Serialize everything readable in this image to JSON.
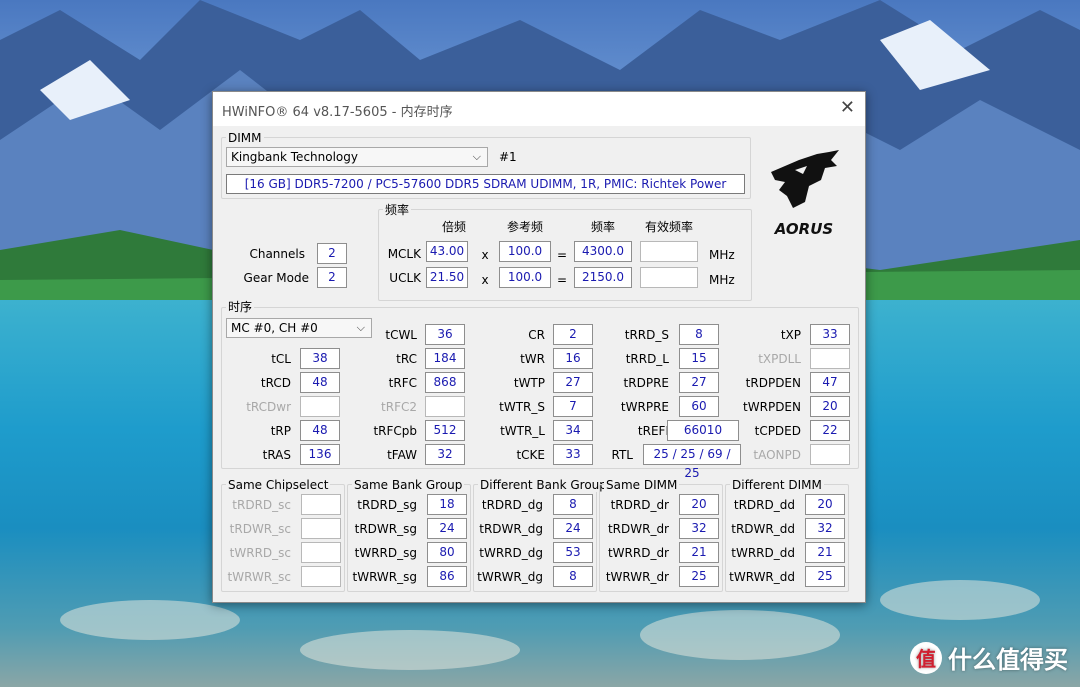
{
  "window": {
    "title": "HWiNFO® 64 v8.17-5605 - 内存时序"
  },
  "dimm": {
    "group_label": "DIMM",
    "manufacturer": "Kingbank Technology",
    "slot": "#1",
    "description": "[16 GB] DDR5-7200 / PC5-57600 DDR5 SDRAM UDIMM, 1R, PMIC: Richtek Power"
  },
  "freq": {
    "group_label": "频率",
    "col_mult": "倍频",
    "col_ref": "参考频",
    "col_freq": "频率",
    "col_eff": "有效频率",
    "mclk": {
      "label": "MCLK",
      "mult": "43.00",
      "ref": "100.0",
      "freq": "4300.0",
      "eff": "",
      "unit": "MHz"
    },
    "uclk": {
      "label": "UCLK",
      "mult": "21.50",
      "ref": "100.0",
      "freq": "2150.0",
      "eff": "",
      "unit": "MHz"
    },
    "op_x": "x",
    "op_eq": "="
  },
  "misc": {
    "channels_label": "Channels",
    "channels": "2",
    "gear_label": "Gear Mode",
    "gear": "2"
  },
  "timing": {
    "group_label": "时序",
    "selector": "MC #0, CH #0",
    "col1": [
      {
        "label": "tCL",
        "value": "38",
        "dim": false
      },
      {
        "label": "tRCD",
        "value": "48",
        "dim": false
      },
      {
        "label": "tRCDwr",
        "value": "",
        "dim": true
      },
      {
        "label": "tRP",
        "value": "48",
        "dim": false
      },
      {
        "label": "tRAS",
        "value": "136",
        "dim": false
      }
    ],
    "col2": [
      {
        "label": "tCWL",
        "value": "36",
        "dim": false
      },
      {
        "label": "tRC",
        "value": "184",
        "dim": false
      },
      {
        "label": "tRFC",
        "value": "868",
        "dim": false
      },
      {
        "label": "tRFC2",
        "value": "",
        "dim": true
      },
      {
        "label": "tRFCpb",
        "value": "512",
        "dim": false
      },
      {
        "label": "tFAW",
        "value": "32",
        "dim": false
      }
    ],
    "col3": [
      {
        "label": "CR",
        "value": "2",
        "dim": false
      },
      {
        "label": "tWR",
        "value": "16",
        "dim": false
      },
      {
        "label": "tWTP",
        "value": "27",
        "dim": false
      },
      {
        "label": "tWTR_S",
        "value": "7",
        "dim": false
      },
      {
        "label": "tWTR_L",
        "value": "34",
        "dim": false
      },
      {
        "label": "tCKE",
        "value": "33",
        "dim": false
      }
    ],
    "col4": [
      {
        "label": "tRRD_S",
        "value": "8",
        "dim": false
      },
      {
        "label": "tRRD_L",
        "value": "15",
        "dim": false
      },
      {
        "label": "tRDPRE",
        "value": "27",
        "dim": false
      },
      {
        "label": "tWRPRE",
        "value": "60",
        "dim": false
      },
      {
        "label": "tREFI",
        "value": "66010",
        "dim": false
      },
      {
        "label": "RTL",
        "value": "25 / 25 / 69 / 25",
        "dim": false
      }
    ],
    "col5": [
      {
        "label": "tXP",
        "value": "33",
        "dim": false
      },
      {
        "label": "tXPDLL",
        "value": "",
        "dim": true
      },
      {
        "label": "tRDPDEN",
        "value": "47",
        "dim": false
      },
      {
        "label": "tWRPDEN",
        "value": "20",
        "dim": false
      },
      {
        "label": "tCPDED",
        "value": "22",
        "dim": false
      },
      {
        "label": "tAONPD",
        "value": "",
        "dim": true
      }
    ]
  },
  "bottom": [
    {
      "title": "Same Chipselect",
      "rows": [
        {
          "label": "tRDRD_sc",
          "value": "",
          "dim": true
        },
        {
          "label": "tRDWR_sc",
          "value": "",
          "dim": true
        },
        {
          "label": "tWRRD_sc",
          "value": "",
          "dim": true
        },
        {
          "label": "tWRWR_sc",
          "value": "",
          "dim": true
        }
      ]
    },
    {
      "title": "Same Bank Group",
      "rows": [
        {
          "label": "tRDRD_sg",
          "value": "18",
          "dim": false
        },
        {
          "label": "tRDWR_sg",
          "value": "24",
          "dim": false
        },
        {
          "label": "tWRRD_sg",
          "value": "80",
          "dim": false
        },
        {
          "label": "tWRWR_sg",
          "value": "86",
          "dim": false
        }
      ]
    },
    {
      "title": "Different Bank Group",
      "rows": [
        {
          "label": "tRDRD_dg",
          "value": "8",
          "dim": false
        },
        {
          "label": "tRDWR_dg",
          "value": "24",
          "dim": false
        },
        {
          "label": "tWRRD_dg",
          "value": "53",
          "dim": false
        },
        {
          "label": "tWRWR_dg",
          "value": "8",
          "dim": false
        }
      ]
    },
    {
      "title": "Same DIMM",
      "rows": [
        {
          "label": "tRDRD_dr",
          "value": "20",
          "dim": false
        },
        {
          "label": "tRDWR_dr",
          "value": "32",
          "dim": false
        },
        {
          "label": "tWRRD_dr",
          "value": "21",
          "dim": false
        },
        {
          "label": "tWRWR_dr",
          "value": "25",
          "dim": false
        }
      ]
    },
    {
      "title": "Different DIMM",
      "rows": [
        {
          "label": "tRDRD_dd",
          "value": "20",
          "dim": false
        },
        {
          "label": "tRDWR_dd",
          "value": "32",
          "dim": false
        },
        {
          "label": "tWRRD_dd",
          "value": "21",
          "dim": false
        },
        {
          "label": "tWRWR_dd",
          "value": "25",
          "dim": false
        }
      ]
    }
  ],
  "logo": {
    "text": "AORUS"
  },
  "watermark": {
    "badge": "值",
    "text": "什么值得买"
  }
}
